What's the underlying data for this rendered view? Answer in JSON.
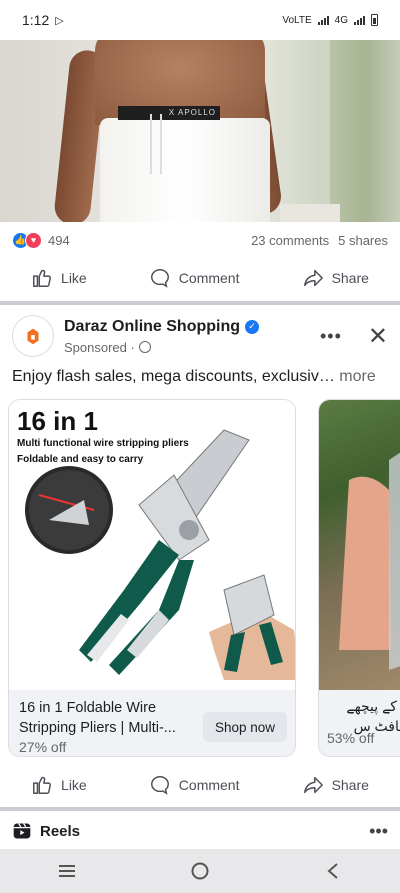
{
  "status_bar": {
    "time": "1:12",
    "network_label": "VoLTE",
    "signal": "4G"
  },
  "top_post": {
    "photo_alt": "",
    "brand_band": "X APOLLO",
    "reaction_count": "494",
    "comments": "23 comments",
    "shares": "5 shares"
  },
  "actions": {
    "like": "Like",
    "comment": "Comment",
    "share": "Share"
  },
  "ad_post": {
    "page_name": "Daraz Online Shopping",
    "sponsored": "Sponsored ·",
    "text": "Enjoy flash sales, mega discounts, exclusiv…",
    "more_label": " more"
  },
  "carousel": {
    "cards": [
      {
        "headline_big": "16 in 1",
        "headline_line1": "Multi functional wire stripping pliers",
        "headline_line2": "Foldable and easy to carry",
        "title": "16 in 1 Foldable Wire Stripping Pliers | Multi-...",
        "discount": "27% off",
        "button": "Shop now"
      },
      {
        "title_line1": "ل کے پیچھے",
        "title_line2": "سافٹ س",
        "discount": "53% off"
      }
    ]
  },
  "reels": {
    "label": "Reels"
  },
  "colors": {
    "facebook_blue": "#1877f2",
    "love_red": "#f33e58",
    "tool_green": "#0f5a4a"
  }
}
